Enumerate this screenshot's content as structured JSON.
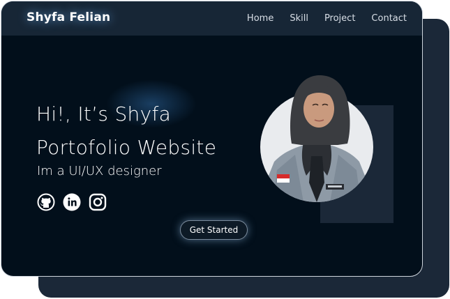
{
  "header": {
    "brand": "Shyfa Felian",
    "nav": [
      "Home",
      "Skill",
      "Project",
      "Contact"
    ]
  },
  "hero": {
    "greeting": "Hi!, It’s Shyfa",
    "subtitle": "Portofolio Website",
    "role": "Im a UI/UX designer",
    "socials": [
      "github-icon",
      "linkedin-icon",
      "instagram-icon"
    ],
    "cta_label": "Get Started"
  },
  "colors": {
    "background": "#020f1b",
    "navbar": "#172636",
    "accent_block": "#1b2838",
    "text": "#ffffff"
  }
}
